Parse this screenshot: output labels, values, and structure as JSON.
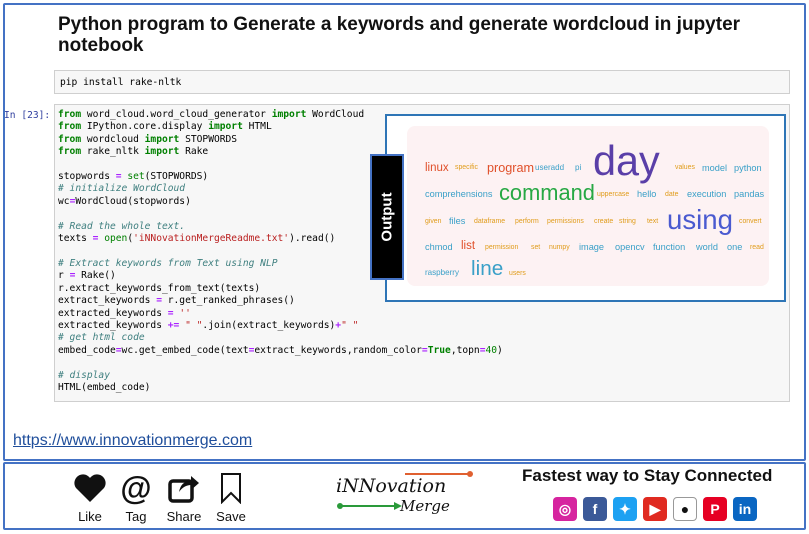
{
  "title": "Python program to Generate a keywords and generate wordcloud in jupyter notebook",
  "pip_cell": "pip install rake-nltk",
  "prompt": "In [23]:",
  "output_label": "Output",
  "code_lines": [
    [
      [
        "kw",
        "from"
      ],
      [
        "t",
        " word_cloud.word_cloud_generator "
      ],
      [
        "kw",
        "import"
      ],
      [
        "t",
        " WordCloud"
      ]
    ],
    [
      [
        "kw",
        "from"
      ],
      [
        "t",
        " IPython.core.display "
      ],
      [
        "kw",
        "import"
      ],
      [
        "t",
        " HTML"
      ]
    ],
    [
      [
        "kw",
        "from"
      ],
      [
        "t",
        " wordcloud "
      ],
      [
        "kw",
        "import"
      ],
      [
        "t",
        " STOPWORDS"
      ]
    ],
    [
      [
        "kw",
        "from"
      ],
      [
        "t",
        " rake_nltk "
      ],
      [
        "kw",
        "import"
      ],
      [
        "t",
        " Rake"
      ]
    ],
    [
      [
        "t",
        ""
      ]
    ],
    [
      [
        "t",
        "stopwords "
      ],
      [
        "op",
        "="
      ],
      [
        "t",
        " "
      ],
      [
        "kw2",
        "set"
      ],
      [
        "t",
        "(STOPWORDS)"
      ]
    ],
    [
      [
        "cm",
        "# initialize WordCloud"
      ]
    ],
    [
      [
        "t",
        "wc"
      ],
      [
        "op",
        "="
      ],
      [
        "t",
        "WordCloud(stopwords)"
      ]
    ],
    [
      [
        "t",
        ""
      ]
    ],
    [
      [
        "cm",
        "# Read the whole text."
      ]
    ],
    [
      [
        "t",
        "texts "
      ],
      [
        "op",
        "="
      ],
      [
        "t",
        " "
      ],
      [
        "kw2",
        "open"
      ],
      [
        "t",
        "("
      ],
      [
        "str",
        "'iNNovationMergeReadme.txt'"
      ],
      [
        "t",
        ").read()"
      ]
    ],
    [
      [
        "t",
        ""
      ]
    ],
    [
      [
        "cm",
        "# Extract keywords from Text using NLP"
      ]
    ],
    [
      [
        "t",
        "r "
      ],
      [
        "op",
        "="
      ],
      [
        "t",
        " Rake()"
      ]
    ],
    [
      [
        "t",
        "r.extract_keywords_from_text(texts)"
      ]
    ],
    [
      [
        "t",
        "extract_keywords "
      ],
      [
        "op",
        "="
      ],
      [
        "t",
        " r.get_ranked_phrases()"
      ]
    ],
    [
      [
        "t",
        "extracted_keywords "
      ],
      [
        "op",
        "="
      ],
      [
        "t",
        " "
      ],
      [
        "str",
        "''"
      ]
    ],
    [
      [
        "t",
        "extracted_keywords "
      ],
      [
        "op",
        "+="
      ],
      [
        "t",
        " "
      ],
      [
        "str",
        "\" \""
      ],
      [
        "t",
        ".join(extract_keywords)"
      ],
      [
        "op",
        "+"
      ],
      [
        "str",
        "\" \""
      ]
    ],
    [
      [
        "cm",
        "# get html code"
      ]
    ],
    [
      [
        "t",
        "embed_code"
      ],
      [
        "op",
        "="
      ],
      [
        "t",
        "wc.get_embed_code(text"
      ],
      [
        "op",
        "="
      ],
      [
        "t",
        "extract_keywords,random_color"
      ],
      [
        "op",
        "="
      ],
      [
        "kw",
        "True"
      ],
      [
        "t",
        ",topn"
      ],
      [
        "op",
        "="
      ],
      [
        "num",
        "40"
      ],
      [
        "t",
        ")"
      ]
    ],
    [
      [
        "t",
        ""
      ]
    ],
    [
      [
        "cm",
        "# display"
      ]
    ],
    [
      [
        "t",
        "HTML(embed_code)"
      ]
    ]
  ],
  "wordcloud": [
    {
      "text": "linux",
      "color": "#e0502a",
      "size": 10
    },
    {
      "text": "specific",
      "color": "#e09c1a",
      "size": 6
    },
    {
      "text": "program",
      "color": "#e0502a",
      "size": 11
    },
    {
      "text": "useradd",
      "color": "#3aa0c8",
      "size": 7
    },
    {
      "text": "pi",
      "color": "#3aa0c8",
      "size": 7
    },
    {
      "text": "day",
      "color": "#5a3fa8",
      "size": 36
    },
    {
      "text": "values",
      "color": "#e09c1a",
      "size": 6
    },
    {
      "text": "model",
      "color": "#3aa0c8",
      "size": 8
    },
    {
      "text": "python",
      "color": "#3aa0c8",
      "size": 8
    },
    {
      "text": "comprehensions",
      "color": "#3aa0c8",
      "size": 8
    },
    {
      "text": "command",
      "color": "#27a844",
      "size": 19
    },
    {
      "text": "uppercase",
      "color": "#e09c1a",
      "size": 6
    },
    {
      "text": "hello",
      "color": "#3aa0c8",
      "size": 8
    },
    {
      "text": "date",
      "color": "#e09c1a",
      "size": 6
    },
    {
      "text": "execution",
      "color": "#3aa0c8",
      "size": 8
    },
    {
      "text": "pandas",
      "color": "#3aa0c8",
      "size": 8
    },
    {
      "text": "given",
      "color": "#e09c1a",
      "size": 6
    },
    {
      "text": "files",
      "color": "#3aa0c8",
      "size": 8
    },
    {
      "text": "dataframe",
      "color": "#e09c1a",
      "size": 6
    },
    {
      "text": "perform",
      "color": "#e09c1a",
      "size": 6
    },
    {
      "text": "permissions",
      "color": "#e09c1a",
      "size": 6
    },
    {
      "text": "create",
      "color": "#e09c1a",
      "size": 6
    },
    {
      "text": "string",
      "color": "#e09c1a",
      "size": 6
    },
    {
      "text": "text",
      "color": "#e09c1a",
      "size": 6
    },
    {
      "text": "using",
      "color": "#4a5ad0",
      "size": 24
    },
    {
      "text": "convert",
      "color": "#e09c1a",
      "size": 6
    },
    {
      "text": "chmod",
      "color": "#3aa0c8",
      "size": 8
    },
    {
      "text": "list",
      "color": "#e0502a",
      "size": 10
    },
    {
      "text": "permission",
      "color": "#e09c1a",
      "size": 6
    },
    {
      "text": "set",
      "color": "#e09c1a",
      "size": 6
    },
    {
      "text": "numpy",
      "color": "#e09c1a",
      "size": 6
    },
    {
      "text": "image",
      "color": "#3aa0c8",
      "size": 8
    },
    {
      "text": "opencv",
      "color": "#3aa0c8",
      "size": 8
    },
    {
      "text": "function",
      "color": "#3aa0c8",
      "size": 8
    },
    {
      "text": "world",
      "color": "#3aa0c8",
      "size": 8
    },
    {
      "text": "one",
      "color": "#3aa0c8",
      "size": 8
    },
    {
      "text": "read",
      "color": "#e09c1a",
      "size": 6
    },
    {
      "text": "raspberry",
      "color": "#3aa0c8",
      "size": 7
    },
    {
      "text": "line",
      "color": "#3aa0c8",
      "size": 18
    },
    {
      "text": "users",
      "color": "#e09c1a",
      "size": 6
    }
  ],
  "link": "https://www.innovationmerge.com",
  "actions": [
    {
      "label": "Like",
      "icon": "heart-icon"
    },
    {
      "label": "Tag",
      "icon": "at-icon"
    },
    {
      "label": "Share",
      "icon": "share-icon"
    },
    {
      "label": "Save",
      "icon": "bookmark-icon"
    }
  ],
  "logo": {
    "line1": "iNNovation",
    "line2": "Merge"
  },
  "tagline": "Fastest way to Stay Connected",
  "social": [
    {
      "name": "instagram-icon",
      "color": "#d6249f",
      "glyph": "◎"
    },
    {
      "name": "facebook-icon",
      "color": "#3b5998",
      "glyph": "f"
    },
    {
      "name": "twitter-icon",
      "color": "#1da1f2",
      "glyph": "✦"
    },
    {
      "name": "youtube-icon",
      "color": "#e02a20",
      "glyph": "▶"
    },
    {
      "name": "github-icon",
      "color": "#ffffff",
      "glyph": "●"
    },
    {
      "name": "pinterest-icon",
      "color": "#e60023",
      "glyph": "P"
    },
    {
      "name": "linkedin-icon",
      "color": "#0a66c2",
      "glyph": "in"
    }
  ]
}
